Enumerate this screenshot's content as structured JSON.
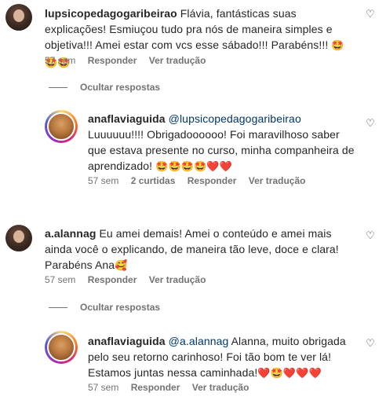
{
  "comments": [
    {
      "username": "lupsicopedagogaribeirao",
      "text": "Flávia, fantásticas suas explicações! Esmiuçou tudo pra nós de maneira simples e objetiva!!! Amei estar com vcs esse sábado!!! Parabéns!!!",
      "emojis": "🤩🤩🤩",
      "time": "57 sem",
      "reply_label": "Responder",
      "translation_label": "Ver tradução"
    },
    {
      "hide_label": "Ocultar respostas"
    },
    {
      "username": "anaflaviaguida",
      "mention": "@lupsicopedagogaribeirao",
      "text": "Luuuuuu!!!! Obrigadoooooo! Foi maravilhoso saber que estava presente no curso, minha companheira de aprendizado!",
      "emojis": "🤩🤩🤩🤩❤️❤️",
      "time": "57 sem",
      "likes": "2 curtidas",
      "reply_label": "Responder",
      "translation_label": "Ver tradução"
    },
    {
      "username": "a.alannag",
      "text": "Eu amei demais! Amei o conteúdo e amei mais ainda você o explicando, de maneira tão leve, doce e clara! Parabéns Ana",
      "emojis": "🥰",
      "time": "57 sem",
      "reply_label": "Responder",
      "translation_label": "Ver tradução"
    },
    {
      "hide_label": "Ocultar respostas"
    },
    {
      "username": "anaflaviaguida",
      "mention": "@a.alannag",
      "text": "Alanna, muito obrigada pelo seu retorno carinhoso! Foi tão bom te ver lá! Estamos juntas nessa caminhada!",
      "emojis": "❤️🤩❤️❤️❤️",
      "time": "57 sem",
      "reply_label": "Responder",
      "translation_label": "Ver tradução"
    }
  ],
  "icons": {
    "like": "heart-outline-icon"
  }
}
